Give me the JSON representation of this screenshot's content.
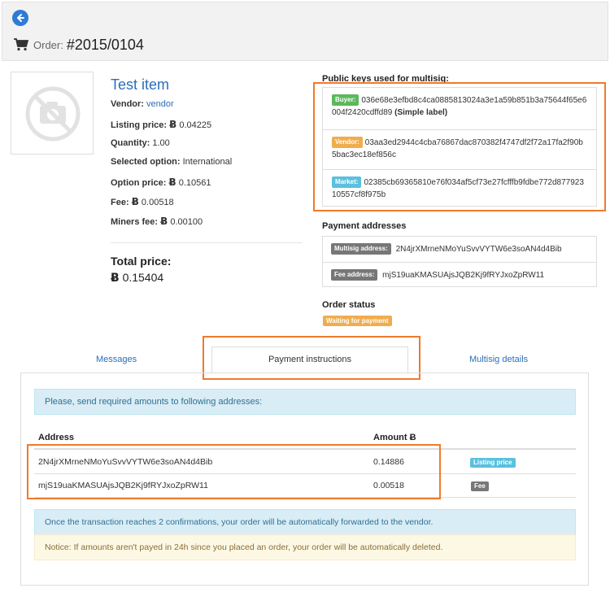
{
  "header": {
    "order_label": "Order:",
    "order_number": "#2015/0104"
  },
  "item": {
    "title": "Test item",
    "vendor_label": "Vendor:",
    "vendor_value": "vendor",
    "listing_price_label": "Listing price:",
    "listing_price_value": "0.04225",
    "quantity_label": "Quantity:",
    "quantity_value": "1.00",
    "selected_option_label": "Selected option:",
    "selected_option_value": "International",
    "option_price_label": "Option price:",
    "option_price_value": "0.10561",
    "fee_label": "Fee:",
    "fee_value": "0.00518",
    "miners_fee_label": "Miners fee:",
    "miners_fee_value": "0.00100",
    "total_label": "Total price:",
    "total_value": "0.15404",
    "btc_symbol": "Ƀ"
  },
  "public_keys": {
    "heading": "Public keys used for multisig:",
    "buyer": {
      "tag": "Buyer:",
      "key": "036e68e3efbd8c4ca0885813024a3e1a59b851b3a75644f65e6004f2420cdffd89",
      "note": "(Simple label)"
    },
    "vendor": {
      "tag": "Vendor:",
      "key": "03aa3ed2944c4cba76867dac870382f4747df2f72a17fa2f90b5bac3ec18ef856c"
    },
    "market": {
      "tag": "Market:",
      "key": "02385cb69365810e76f034af5cf73e27fcfffb9fdbe772d87792310557cf8f975b"
    }
  },
  "payment_addresses": {
    "heading": "Payment addresses",
    "multisig": {
      "tag": "Multisig address:",
      "value": "2N4jrXMrneNMoYuSvvVYTW6e3soAN4d4Bib"
    },
    "fee": {
      "tag": "Fee address:",
      "value": "mjS19uaKMASUAjsJQB2Kj9fRYJxoZpRW11"
    }
  },
  "order_status": {
    "heading": "Order status",
    "badge": "Waiting for payment"
  },
  "tabs": {
    "messages": "Messages",
    "payment_instructions": "Payment instructions",
    "multisig_details": "Multisig details"
  },
  "payment": {
    "intro": "Please, send required amounts to following addresses:",
    "col_address": "Address",
    "col_amount": "Amount Ƀ",
    "rows": [
      {
        "address": "2N4jrXMrneNMoYuSvvVYTW6e3soAN4d4Bib",
        "amount": "0.14886",
        "tag": "Listing price"
      },
      {
        "address": "mjS19uaKMASUAjsJQB2Kj9fRYJxoZpRW11",
        "amount": "0.00518",
        "tag": "Fee"
      }
    ],
    "confirm_notice": "Once the transaction reaches 2 confirmations, your order will be automatically forwarded to the vendor.",
    "delete_notice": "Notice: If amounts aren't payed in 24h since you placed an order, your order will be automatically deleted."
  },
  "colors": {
    "highlight": "#f07a2a",
    "link": "#2a6ebb",
    "buyer_tag": "#5cb85c",
    "vendor_tag": "#f0ad4e",
    "market_tag": "#5bc0de",
    "info_alert": "#d9edf7",
    "warning_alert": "#fcf8e3"
  },
  "icons": [
    "back-arrow-icon",
    "cart-icon",
    "no-image-icon"
  ]
}
